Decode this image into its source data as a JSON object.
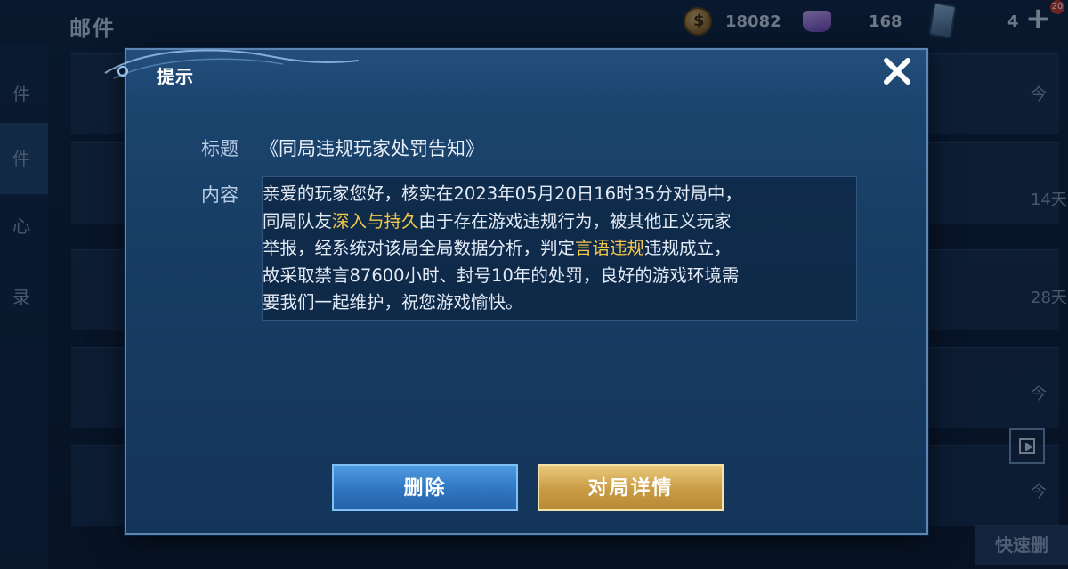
{
  "background": {
    "screen_title": "邮件",
    "resources": {
      "coins": "18082",
      "gems": "168",
      "cards": "4"
    },
    "badge": "20",
    "sidebar": [
      "件",
      "件",
      "心",
      "录"
    ],
    "right_texts": [
      "今",
      "14天",
      "28天",
      "今",
      "今"
    ],
    "quick_delete_label": "快速删"
  },
  "dialog": {
    "title": "提示",
    "subject_label": "标题",
    "subject_value": "《同局违规玩家处罚告知》",
    "content_label": "内容",
    "content": {
      "line1": "亲爱的玩家您好，核实在2023年05月20日16时35分对局中，",
      "line2_pre": "同局队友",
      "line2_hl": "深入与持久",
      "line2_post": "由于存在游戏违规行为，被其他正义玩家",
      "line3_pre": "举报，经系统对该局全局数据分析，判定",
      "line3_hl": "言语违规",
      "line3_post": "违规成立，",
      "line4": "故采取禁言87600小时、封号10年的处罚，良好的游戏环境需",
      "line5": "要我们一起维护，祝您游戏愉快。"
    },
    "buttons": {
      "delete": "删除",
      "details": "对局详情"
    }
  },
  "colors": {
    "highlight": "#f2c64a",
    "delete_button": "#2f75c0",
    "details_button": "#c89b45",
    "dialog_bg": "#183e65"
  }
}
